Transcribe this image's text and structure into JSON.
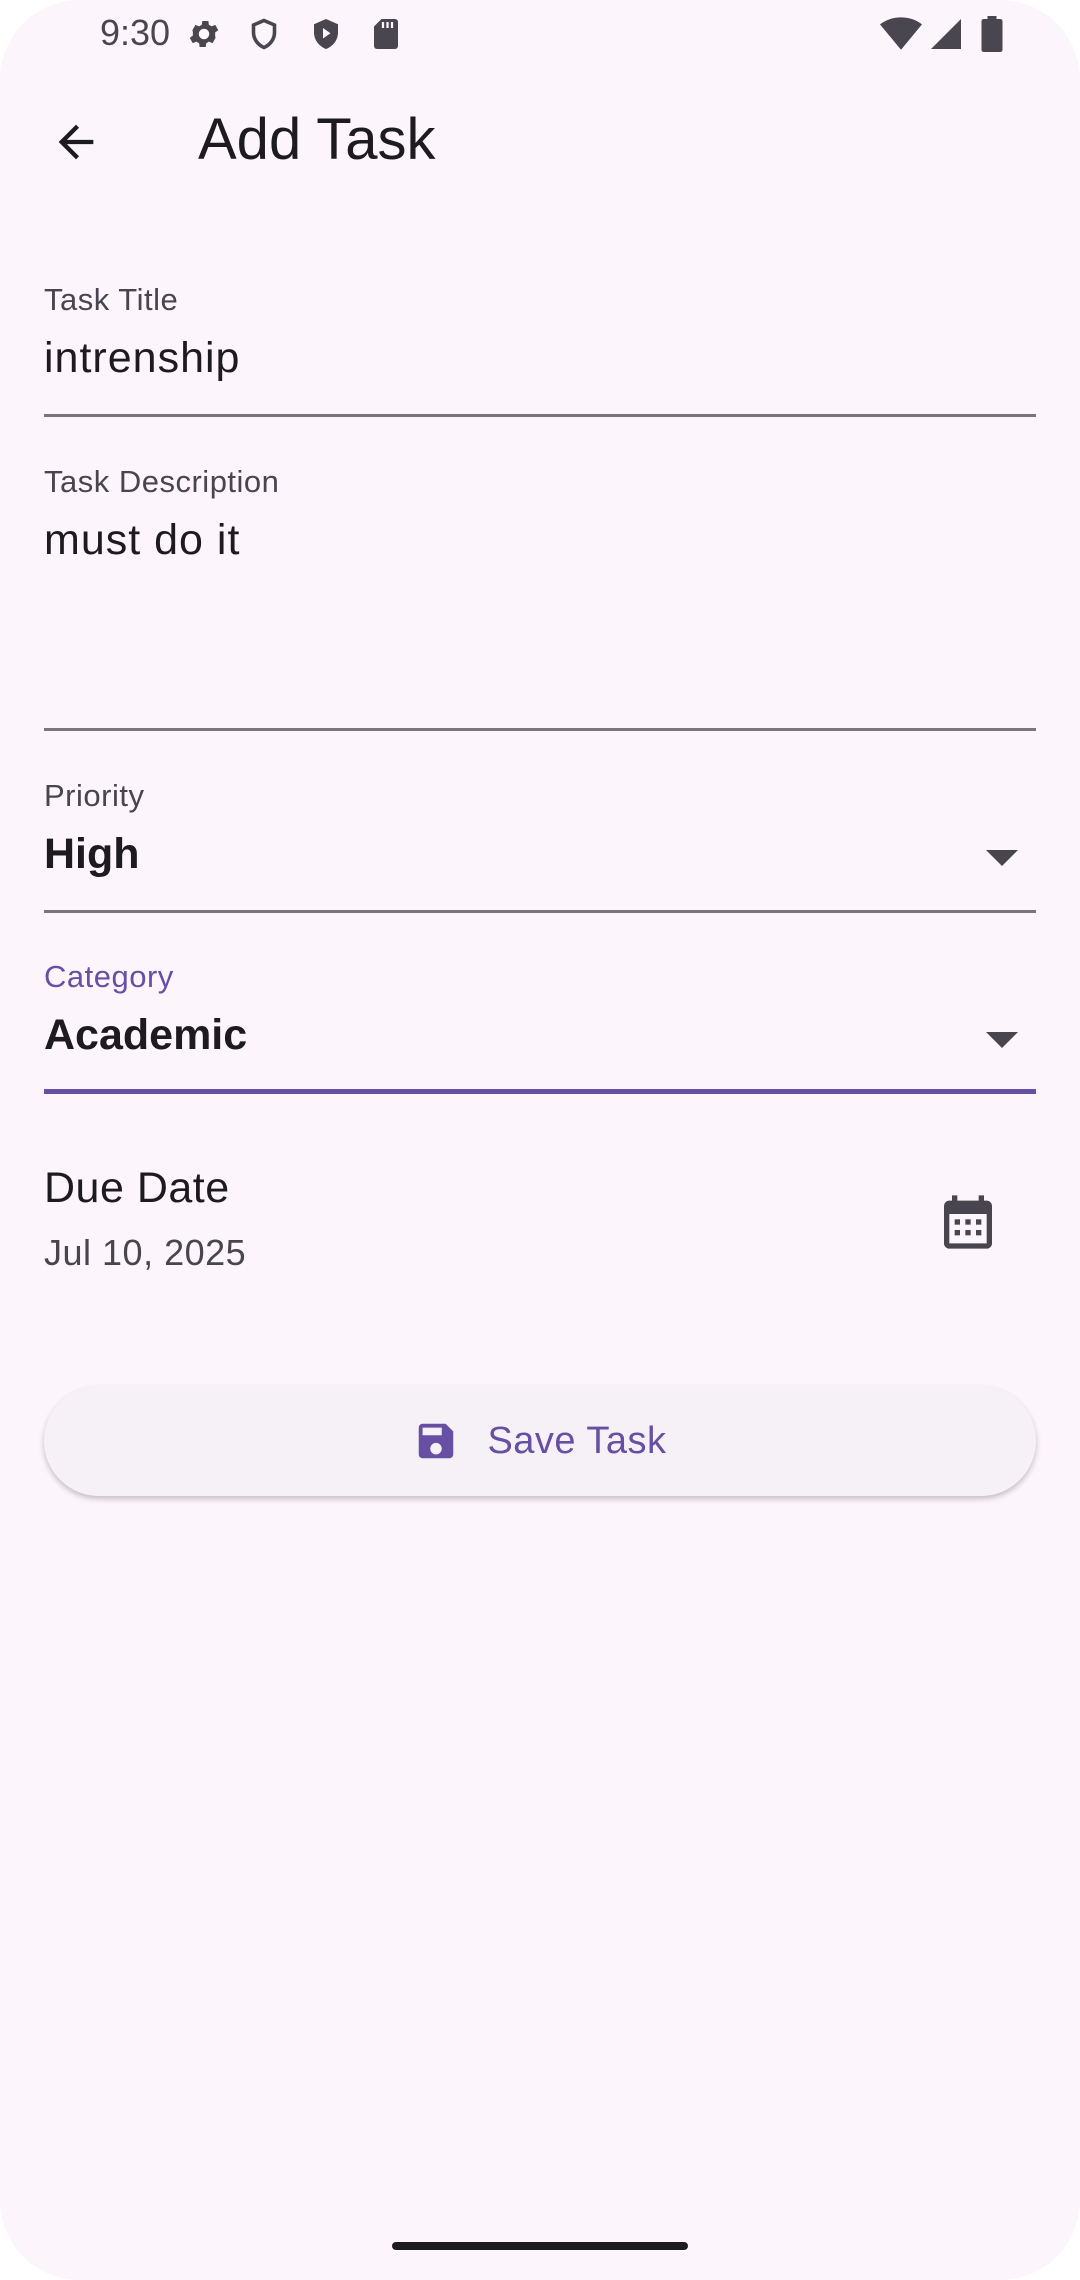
{
  "status_bar": {
    "time": "9:30",
    "icons": [
      "gear-icon",
      "shield-icon",
      "play-shield-icon",
      "sd-card-icon",
      "wifi-icon",
      "signal-icon",
      "battery-icon"
    ]
  },
  "app_bar": {
    "title": "Add Task",
    "back_icon": "arrow-back-icon"
  },
  "form": {
    "task_title": {
      "label": "Task Title",
      "value": "intrenship"
    },
    "task_description": {
      "label": "Task Description",
      "value": "must do it"
    },
    "priority": {
      "label": "Priority",
      "value": "High"
    },
    "category": {
      "label": "Category",
      "value": "Academic"
    },
    "due_date": {
      "label": "Due Date",
      "value": "Jul 10, 2025",
      "icon": "calendar-icon"
    }
  },
  "save_button": {
    "label": "Save Task",
    "icon": "save-icon"
  },
  "colors": {
    "background": "#fcf5fb",
    "accent": "#6750a4",
    "text": "#1d1b20",
    "secondary_text": "#49454f",
    "underline": "#79757f"
  }
}
